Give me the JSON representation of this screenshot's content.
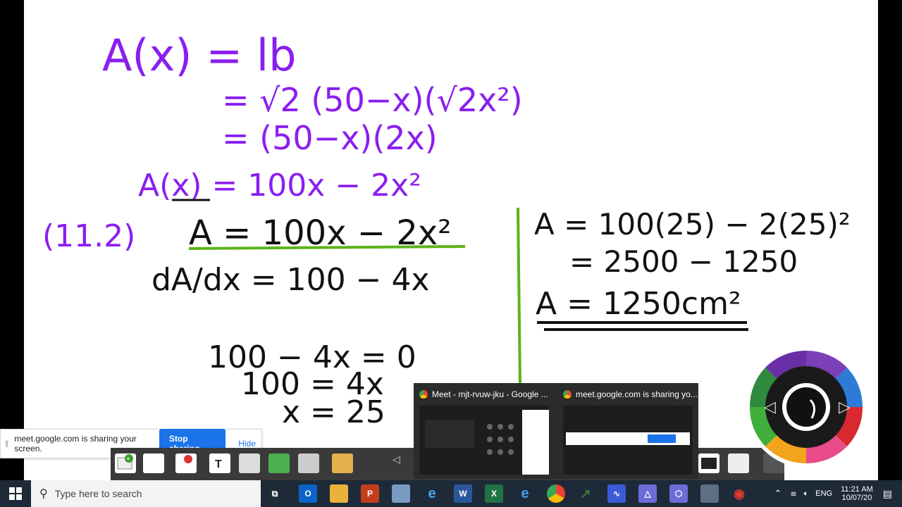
{
  "whiteboard": {
    "lines": [
      {
        "id": "a_def",
        "text": "A(x) = lb"
      },
      {
        "id": "l2",
        "text": "= √2 (50−x)(√2x²)"
      },
      {
        "id": "l3",
        "text": "= (50−x)(2x)"
      },
      {
        "id": "l4",
        "text": "A(x) = 100x − 2x²"
      },
      {
        "id": "q_label",
        "text": "(11.2)"
      },
      {
        "id": "r1",
        "text": "A = 100x − 2x²"
      },
      {
        "id": "r2",
        "text": "dA/dx = 100 − 4x"
      },
      {
        "id": "r3",
        "text": "100 − 4x = 0"
      },
      {
        "id": "r4",
        "text": "100 = 4x"
      },
      {
        "id": "r5",
        "text": "x = 25"
      },
      {
        "id": "s1",
        "text": "A = 100(25) − 2(25)²"
      },
      {
        "id": "s2",
        "text": "= 2500 − 1250"
      },
      {
        "id": "s3",
        "text": "A = 1250cm²"
      }
    ],
    "colors": {
      "purple": "#8a1ef0",
      "black": "#111111",
      "green": "#5db31b"
    }
  },
  "sharebar": {
    "message": "meet.google.com is sharing your screen.",
    "stop_label": "Stop sharing",
    "hide_label": "Hide"
  },
  "thumbnails": [
    {
      "title": "Meet - mjt-rvuw-jku - Google ..."
    },
    {
      "title": "meet.google.com is sharing yo..."
    }
  ],
  "taskbar": {
    "search_placeholder": "Type here to search",
    "apps": [
      "task-view",
      "outlook",
      "file-explorer",
      "powerpoint",
      "ms-paint-3d",
      "internet-explorer",
      "word",
      "excel",
      "edge",
      "chrome",
      "app-a",
      "app-b",
      "app-c",
      "app-d",
      "smart-notebook",
      "app-e"
    ],
    "tray": {
      "lang": "ENG",
      "time": "11:21 AM",
      "date": "10/07/20"
    }
  }
}
